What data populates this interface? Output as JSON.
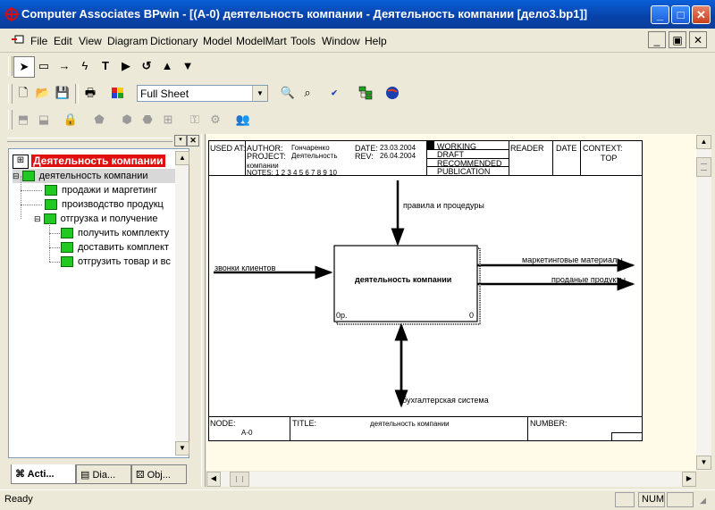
{
  "window": {
    "title": "Computer Associates BPwin - [(A-0) деятельность компании - Деятельность компании  [дело3.bp1]]"
  },
  "menu": [
    "File",
    "Edit",
    "View",
    "Diagram",
    "Dictionary",
    "Model",
    "ModelMart",
    "Tools",
    "Window",
    "Help"
  ],
  "toolbar": {
    "zoom_select_value": "Full Sheet"
  },
  "tree": {
    "root": "Деятельность компании",
    "items": [
      {
        "label": "деятельность компании"
      },
      {
        "label": "продажи и  маргетинг"
      },
      {
        "label": "производство  продукц"
      },
      {
        "label": "отгрузка и получение"
      },
      {
        "label": "получить комплекту"
      },
      {
        "label": "доставить  комплект"
      },
      {
        "label": "отгрузить товар и вс"
      }
    ]
  },
  "tabs": [
    "Acti...",
    "Dia...",
    "Obj..."
  ],
  "diagram": {
    "used_at": "USED AT:",
    "author_label": "AUTHOR:",
    "author": "Гончаренко",
    "date_label": "DATE:",
    "date": "23.03.2004",
    "project_label": "PROJECT:",
    "project": "Деятельность",
    "project_cont": "компании",
    "rev_label": "REV:",
    "rev": "26.04.2004",
    "notes": "NOTES:  1  2  3  4  5  6  7  8  9  10",
    "status": [
      "WORKING",
      "DRAFT",
      "RECOMMENDED",
      "PUBLICATION"
    ],
    "reader": "READER",
    "date2": "DATE",
    "context": "CONTEXT:",
    "context_val": "TOP",
    "box_label": "деятельность компании",
    "box_cost": "0р.",
    "box_num": "0",
    "control": "правила и процедуры",
    "input": "звонки клиентов",
    "output1": "маркетинговые материалы",
    "output2": "проданые продукты",
    "mechanism": "бухгалтерская система",
    "node_label": "NODE:",
    "node": "A-0",
    "title_label": "TITLE:",
    "title": "деятельность компании",
    "number_label": "NUMBER:"
  },
  "statusbar": {
    "text": "Ready",
    "num": "NUM"
  }
}
